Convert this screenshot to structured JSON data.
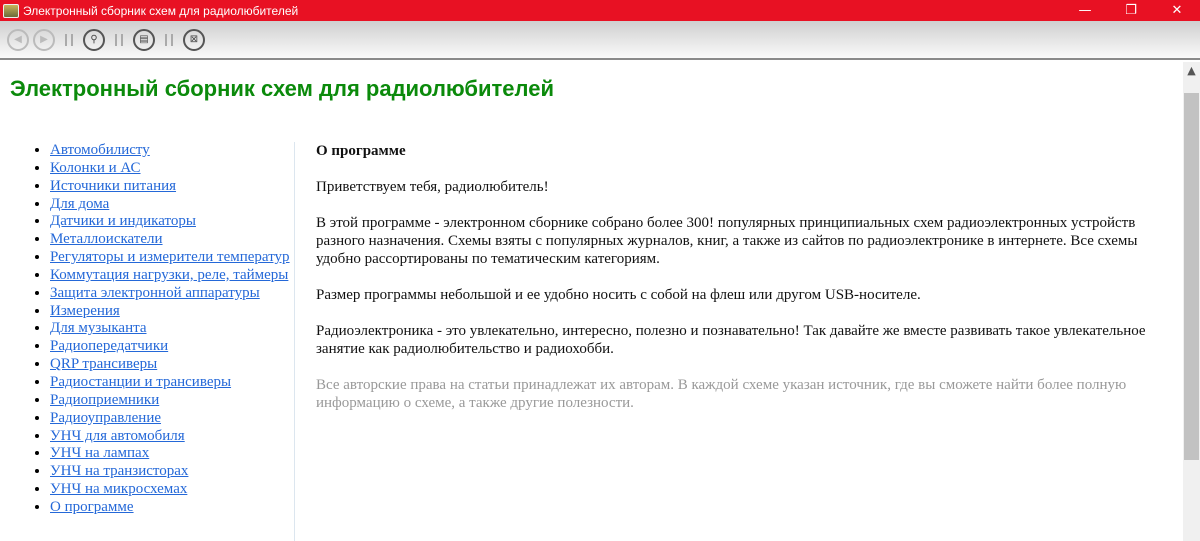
{
  "window": {
    "title": "Электронный сборник схем для радиолюбителей"
  },
  "toolbar": {
    "buttons": [
      "back",
      "forward",
      "search",
      "contents",
      "exit"
    ]
  },
  "page": {
    "heading": "Электронный сборник схем для радиолюбителей"
  },
  "nav": {
    "items": [
      "Автомобилисту",
      "Колонки и АС",
      "Источники питания",
      "Для дома",
      "Датчики и индикаторы",
      "Металлоискатели",
      "Регуляторы и измерители температур",
      "Коммутация нагрузки, реле, таймеры",
      "Защита электронной аппаратуры",
      "Измерения",
      "Для музыканта",
      "Радиопередатчики",
      "QRP трансиверы",
      "Радиостанции и трансиверы",
      "Радиоприемники",
      "Радиоуправление",
      "УНЧ для автомобиля",
      "УНЧ на лампах",
      "УНЧ на транзисторах",
      "УНЧ на микросхемах",
      "О программе"
    ]
  },
  "content": {
    "title": "О программе",
    "greeting": "Приветствуем тебя, радиолюбитель!",
    "p1": "В этой программе - электронном сборнике собрано более 300! популярных принципиальных схем радиоэлектронных устройств разного назначения.  Схемы взяты с популярных журналов, книг, а также из сайтов по радиоэлектронике в интернете.  Все схемы удобно рассортированы по тематическим категориям.",
    "p2": "Размер программы небольшой и ее удобно носить с собой на флеш или другом USB-носителе.",
    "p3": "Радиоэлектроника - это увлекательно, интересно, полезно и познавательно! Так давайте же вместе развивать такое увлекательное занятие как радиолюбительство и радиохобби.",
    "copyright": "Все авторские права на статьи принадлежат их авторам. В каждой схеме указан источник, где вы сможете найти более полную информацию о схеме, а также другие полезности."
  }
}
